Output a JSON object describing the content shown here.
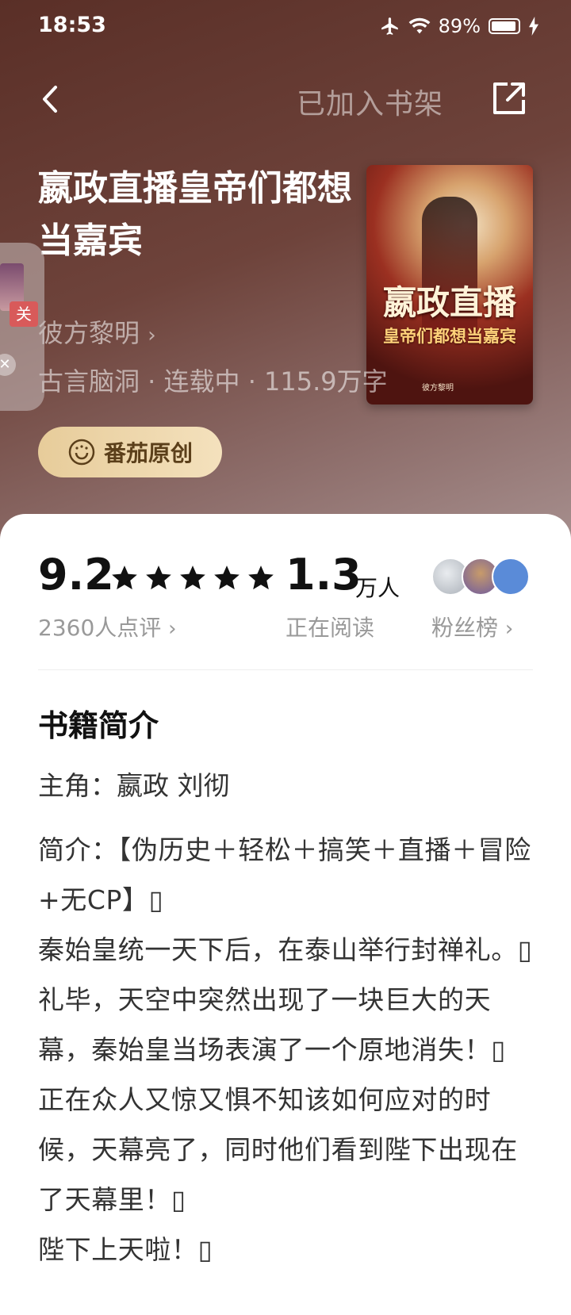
{
  "status_bar": {
    "time": "18:53",
    "battery": "89%"
  },
  "nav": {
    "shelf_label": "已加入书架"
  },
  "book": {
    "title": "嬴政直播皇帝们都想当嘉宾",
    "author": "彼方黎明",
    "meta": "古言脑洞 · 连载中 · 115.9万字",
    "badge": "番茄原创",
    "cover_title": "嬴政直播",
    "cover_subtitle": "皇帝们都想当嘉宾",
    "cover_author": "彼方黎明"
  },
  "floating_widget": {
    "tag": "关",
    "close": "✕"
  },
  "stats": {
    "rating": "9.2",
    "stars": 5,
    "reviews": "2360人点评",
    "readers": "1.3",
    "readers_unit": "万人",
    "reading_label": "正在阅读",
    "fans_label": "粉丝榜"
  },
  "intro": {
    "heading": "书籍简介",
    "protagonist": "主角：嬴政 刘彻",
    "paragraphs": [
      "简介：【伪历史＋轻松＋搞笑＋直播＋冒险+无CP】▯",
      "秦始皇统一天下后，在泰山举行封禅礼。▯",
      "礼毕，天空中突然出现了一块巨大的天幕，秦始皇当场表演了一个原地消失！▯",
      "正在众人又惊又惧不知该如何应对的时候，天幕亮了，同时他们看到陛下出现在了天幕里！▯",
      "陛下上天啦！▯"
    ]
  }
}
